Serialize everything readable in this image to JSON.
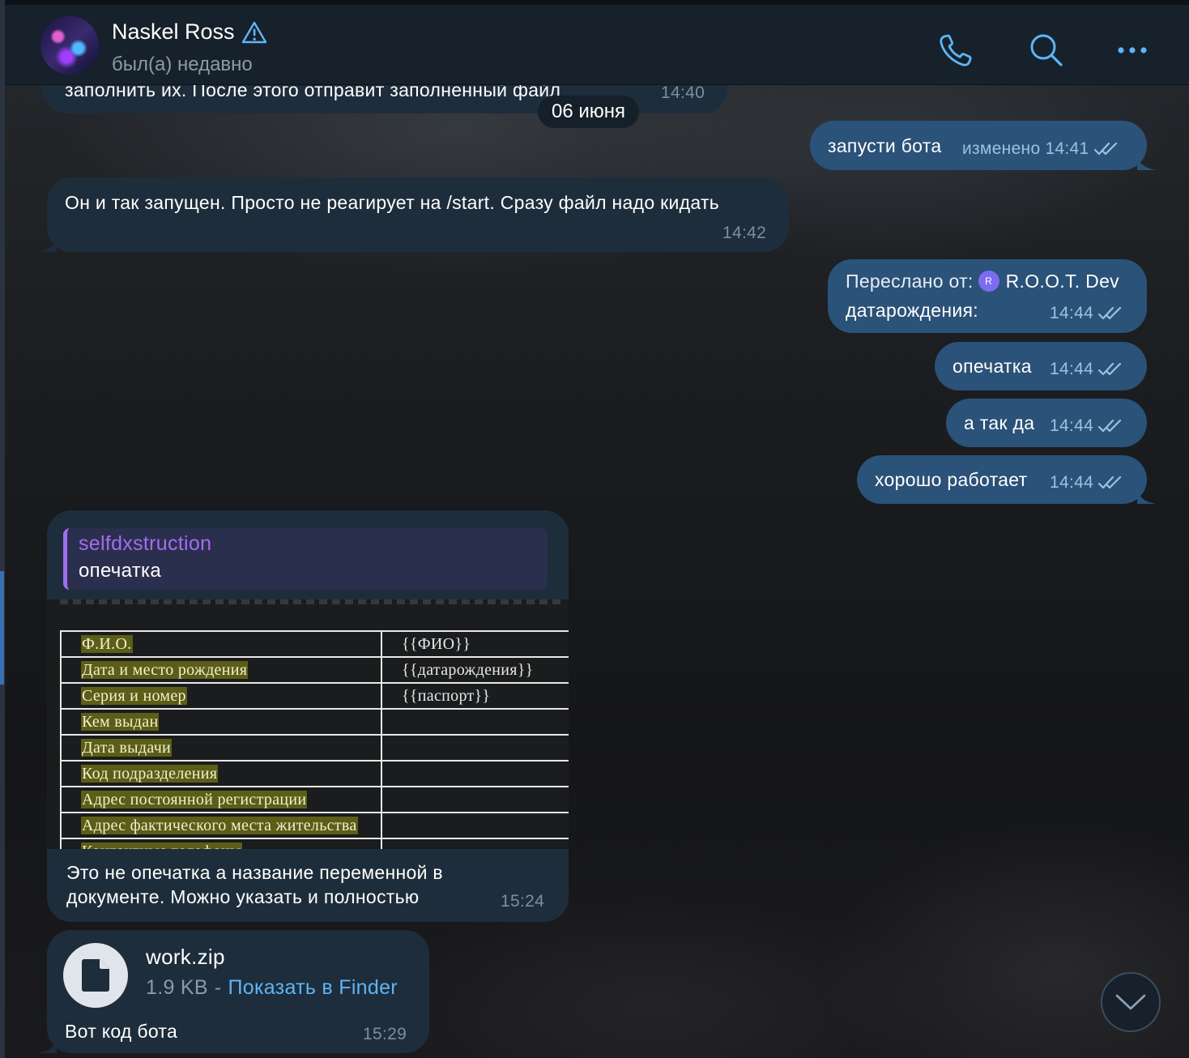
{
  "header": {
    "name": "Naskel Ross",
    "status": "был(а) недавно"
  },
  "date_separator": "06 июня",
  "messages": [
    {
      "id": "m0",
      "direction": "in",
      "text": "заполнить их. После этого отправит заполненный файл",
      "time": "14:40"
    },
    {
      "id": "m1",
      "direction": "out",
      "text": "запусти бота",
      "edited": "изменено",
      "time": "14:41"
    },
    {
      "id": "m2",
      "direction": "in",
      "text": "Он и так запущен. Просто не реагирует на /start. Сразу файл надо кидать",
      "time": "14:42"
    },
    {
      "id": "m3",
      "direction": "out",
      "forward_label": "Переслано от:",
      "forward_badge": "R",
      "forward_from": "R.O.O.T. Dev",
      "text": "датарождения:",
      "time": "14:44"
    },
    {
      "id": "m4",
      "direction": "out",
      "text": "опечатка",
      "time": "14:44"
    },
    {
      "id": "m5",
      "direction": "out",
      "text": "а так да",
      "time": "14:44"
    },
    {
      "id": "m6",
      "direction": "out",
      "text": "хорошо работает",
      "time": "14:44"
    },
    {
      "id": "m7",
      "direction": "in",
      "reply": {
        "name": "selfdxstruction",
        "text": "опечатка"
      },
      "document": {
        "rows": [
          {
            "key": "Ф.И.О.",
            "value": "{{ФИО}}"
          },
          {
            "key": "Дата и место рождения",
            "value": "{{датарождения}}"
          },
          {
            "key": "Серия и номер",
            "value": "{{паспорт}}"
          },
          {
            "key": "Кем выдан",
            "value": ""
          },
          {
            "key": "Дата выдачи",
            "value": ""
          },
          {
            "key": "Код подразделения",
            "value": ""
          },
          {
            "key": "Адрес постоянной регистрации",
            "value": ""
          },
          {
            "key": "Адрес фактического места жительства",
            "value": ""
          },
          {
            "key": "Контактные телефоны",
            "value": ""
          }
        ]
      },
      "text_line1": "Это не опечатка а название переменной в",
      "text_line2": "документе. Можно указать и полностью",
      "time": "15:24"
    },
    {
      "id": "m8",
      "direction": "in",
      "file": {
        "name": "work.zip",
        "size": "1.9 KB",
        "separator": "-",
        "action": "Показать в Finder"
      },
      "caption": "Вот код бота",
      "time": "15:29"
    }
  ],
  "icons": {
    "call": "phone-icon",
    "search": "search-icon",
    "more": "more-icon",
    "warning": "warning-icon",
    "read": "double-check-icon",
    "file": "file-icon",
    "scroll": "chevron-down-icon"
  },
  "colors": {
    "accent": "#5eb5f7",
    "outgoing_bubble": "#2b5278",
    "incoming_bubble": "#1e2d3b",
    "header": "#17212b",
    "reply_name": "#a66cf0"
  }
}
